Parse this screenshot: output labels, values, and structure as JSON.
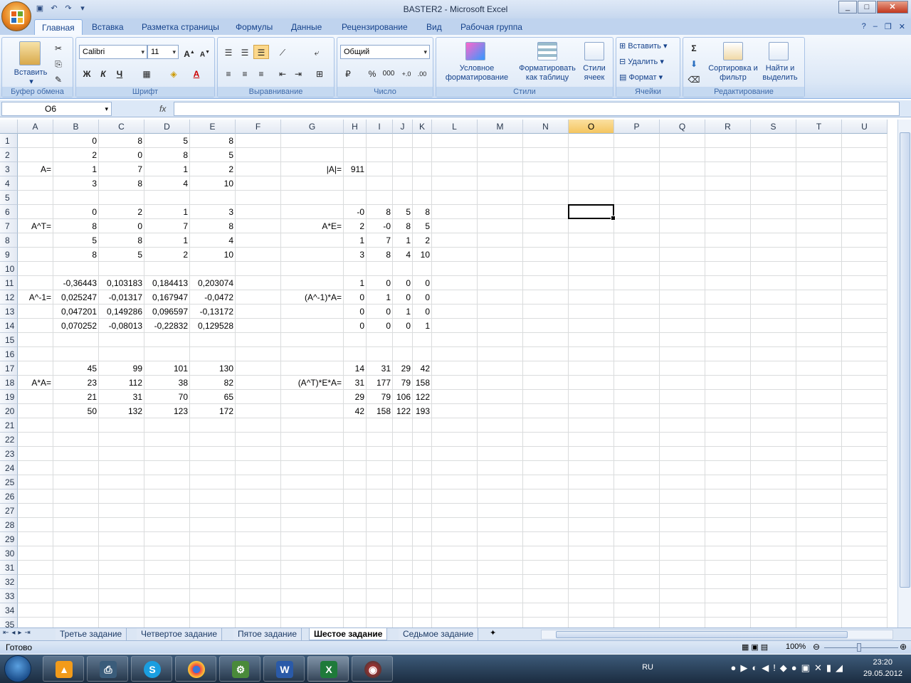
{
  "window": {
    "title": "BASTER2  -  Microsoft Excel"
  },
  "ribbon_tabs": [
    "Главная",
    "Вставка",
    "Разметка страницы",
    "Формулы",
    "Данные",
    "Рецензирование",
    "Вид",
    "Рабочая группа"
  ],
  "ribbon": {
    "clipboard": {
      "paste": "Вставить",
      "label": "Буфер обмена"
    },
    "font": {
      "name": "Calibri",
      "size": "11",
      "bold": "Ж",
      "italic": "К",
      "underline": "Ч",
      "label": "Шрифт"
    },
    "alignment": {
      "label": "Выравнивание"
    },
    "number": {
      "format": "Общий",
      "percent": "%",
      "thousands": "000",
      "label": "Число"
    },
    "styles": {
      "conditional": "Условное форматирование",
      "as_table": "Форматировать как таблицу",
      "cell_styles": "Стили ячеек",
      "label": "Стили"
    },
    "cells": {
      "insert": "Вставить",
      "delete": "Удалить",
      "format": "Формат",
      "label": "Ячейки"
    },
    "editing": {
      "sort": "Сортировка и фильтр",
      "find": "Найти и выделить",
      "label": "Редактирование"
    }
  },
  "formula_bar": {
    "name_box": "O6",
    "fx": "fx",
    "formula": ""
  },
  "columns": [
    "A",
    "B",
    "C",
    "D",
    "E",
    "F",
    "G",
    "H",
    "I",
    "J",
    "K",
    "L",
    "M",
    "N",
    "O",
    "P",
    "Q",
    "R",
    "S",
    "T",
    "U"
  ],
  "selected_column": "O",
  "rows": [
    "1",
    "2",
    "3",
    "4",
    "5",
    "6",
    "7",
    "8",
    "9",
    "10",
    "11",
    "12",
    "13",
    "14",
    "15",
    "16",
    "17",
    "18",
    "19",
    "20",
    "21",
    "22",
    "23",
    "24",
    "25",
    "26",
    "27",
    "28",
    "29",
    "30",
    "31",
    "32",
    "33",
    "34",
    "35"
  ],
  "cells": [
    [
      "B1",
      "0"
    ],
    [
      "C1",
      "8"
    ],
    [
      "D1",
      "5"
    ],
    [
      "E1",
      "8"
    ],
    [
      "B2",
      "2"
    ],
    [
      "C2",
      "0"
    ],
    [
      "D2",
      "8"
    ],
    [
      "E2",
      "5"
    ],
    [
      "A3",
      "A="
    ],
    [
      "B3",
      "1"
    ],
    [
      "C3",
      "7"
    ],
    [
      "D3",
      "1"
    ],
    [
      "E3",
      "2"
    ],
    [
      "G3",
      "|A|="
    ],
    [
      "H3",
      "911"
    ],
    [
      "B4",
      "3"
    ],
    [
      "C4",
      "8"
    ],
    [
      "D4",
      "4"
    ],
    [
      "E4",
      "10"
    ],
    [
      "B6",
      "0"
    ],
    [
      "C6",
      "2"
    ],
    [
      "D6",
      "1"
    ],
    [
      "E6",
      "3"
    ],
    [
      "H6",
      "-0"
    ],
    [
      "I6",
      "8"
    ],
    [
      "J6",
      "5"
    ],
    [
      "K6",
      "8"
    ],
    [
      "A7",
      "A^T="
    ],
    [
      "B7",
      "8"
    ],
    [
      "C7",
      "0"
    ],
    [
      "D7",
      "7"
    ],
    [
      "E7",
      "8"
    ],
    [
      "G7",
      "A*E="
    ],
    [
      "H7",
      "2"
    ],
    [
      "I7",
      "-0"
    ],
    [
      "J7",
      "8"
    ],
    [
      "K7",
      "5"
    ],
    [
      "B8",
      "5"
    ],
    [
      "C8",
      "8"
    ],
    [
      "D8",
      "1"
    ],
    [
      "E8",
      "4"
    ],
    [
      "H8",
      "1"
    ],
    [
      "I8",
      "7"
    ],
    [
      "J8",
      "1"
    ],
    [
      "K8",
      "2"
    ],
    [
      "B9",
      "8"
    ],
    [
      "C9",
      "5"
    ],
    [
      "D9",
      "2"
    ],
    [
      "E9",
      "10"
    ],
    [
      "H9",
      "3"
    ],
    [
      "I9",
      "8"
    ],
    [
      "J9",
      "4"
    ],
    [
      "K9",
      "10"
    ],
    [
      "B11",
      "-0,36443"
    ],
    [
      "C11",
      "0,103183"
    ],
    [
      "D11",
      "0,184413"
    ],
    [
      "E11",
      "0,203074"
    ],
    [
      "H11",
      "1"
    ],
    [
      "I11",
      "0"
    ],
    [
      "J11",
      "0"
    ],
    [
      "K11",
      "0"
    ],
    [
      "A12",
      "A^-1="
    ],
    [
      "B12",
      "0,025247"
    ],
    [
      "C12",
      "-0,01317"
    ],
    [
      "D12",
      "0,167947"
    ],
    [
      "E12",
      "-0,0472"
    ],
    [
      "G12",
      "(A^-1)*A="
    ],
    [
      "H12",
      "0"
    ],
    [
      "I12",
      "1"
    ],
    [
      "J12",
      "0"
    ],
    [
      "K12",
      "0"
    ],
    [
      "B13",
      "0,047201"
    ],
    [
      "C13",
      "0,149286"
    ],
    [
      "D13",
      "0,096597"
    ],
    [
      "E13",
      "-0,13172"
    ],
    [
      "H13",
      "0"
    ],
    [
      "I13",
      "0"
    ],
    [
      "J13",
      "1"
    ],
    [
      "K13",
      "0"
    ],
    [
      "B14",
      "0,070252"
    ],
    [
      "C14",
      "-0,08013"
    ],
    [
      "D14",
      "-0,22832"
    ],
    [
      "E14",
      "0,129528"
    ],
    [
      "H14",
      "0"
    ],
    [
      "I14",
      "0"
    ],
    [
      "J14",
      "0"
    ],
    [
      "K14",
      "1"
    ],
    [
      "B17",
      "45"
    ],
    [
      "C17",
      "99"
    ],
    [
      "D17",
      "101"
    ],
    [
      "E17",
      "130"
    ],
    [
      "H17",
      "14"
    ],
    [
      "I17",
      "31"
    ],
    [
      "J17",
      "29"
    ],
    [
      "K17",
      "42"
    ],
    [
      "A18",
      "A*A="
    ],
    [
      "B18",
      "23"
    ],
    [
      "C18",
      "112"
    ],
    [
      "D18",
      "38"
    ],
    [
      "E18",
      "82"
    ],
    [
      "G18",
      "(A^T)*E*A="
    ],
    [
      "H18",
      "31"
    ],
    [
      "I18",
      "177"
    ],
    [
      "J18",
      "79"
    ],
    [
      "K18",
      "158"
    ],
    [
      "B19",
      "21"
    ],
    [
      "C19",
      "31"
    ],
    [
      "D19",
      "70"
    ],
    [
      "E19",
      "65"
    ],
    [
      "H19",
      "29"
    ],
    [
      "I19",
      "79"
    ],
    [
      "J19",
      "106"
    ],
    [
      "K19",
      "122"
    ],
    [
      "B20",
      "50"
    ],
    [
      "C20",
      "132"
    ],
    [
      "D20",
      "123"
    ],
    [
      "E20",
      "172"
    ],
    [
      "H20",
      "42"
    ],
    [
      "I20",
      "158"
    ],
    [
      "J20",
      "122"
    ],
    [
      "K20",
      "193"
    ]
  ],
  "sheet_tabs": [
    "Третье задание",
    "Четвертое задание",
    "Пятое задание",
    "Шестое задание",
    "Седьмое задание"
  ],
  "active_sheet": "Шестое задание",
  "status": {
    "ready": "Готово",
    "zoom": "100%"
  },
  "taskbar": {
    "lang": "RU",
    "time": "23:20",
    "date": "29.05.2012"
  }
}
